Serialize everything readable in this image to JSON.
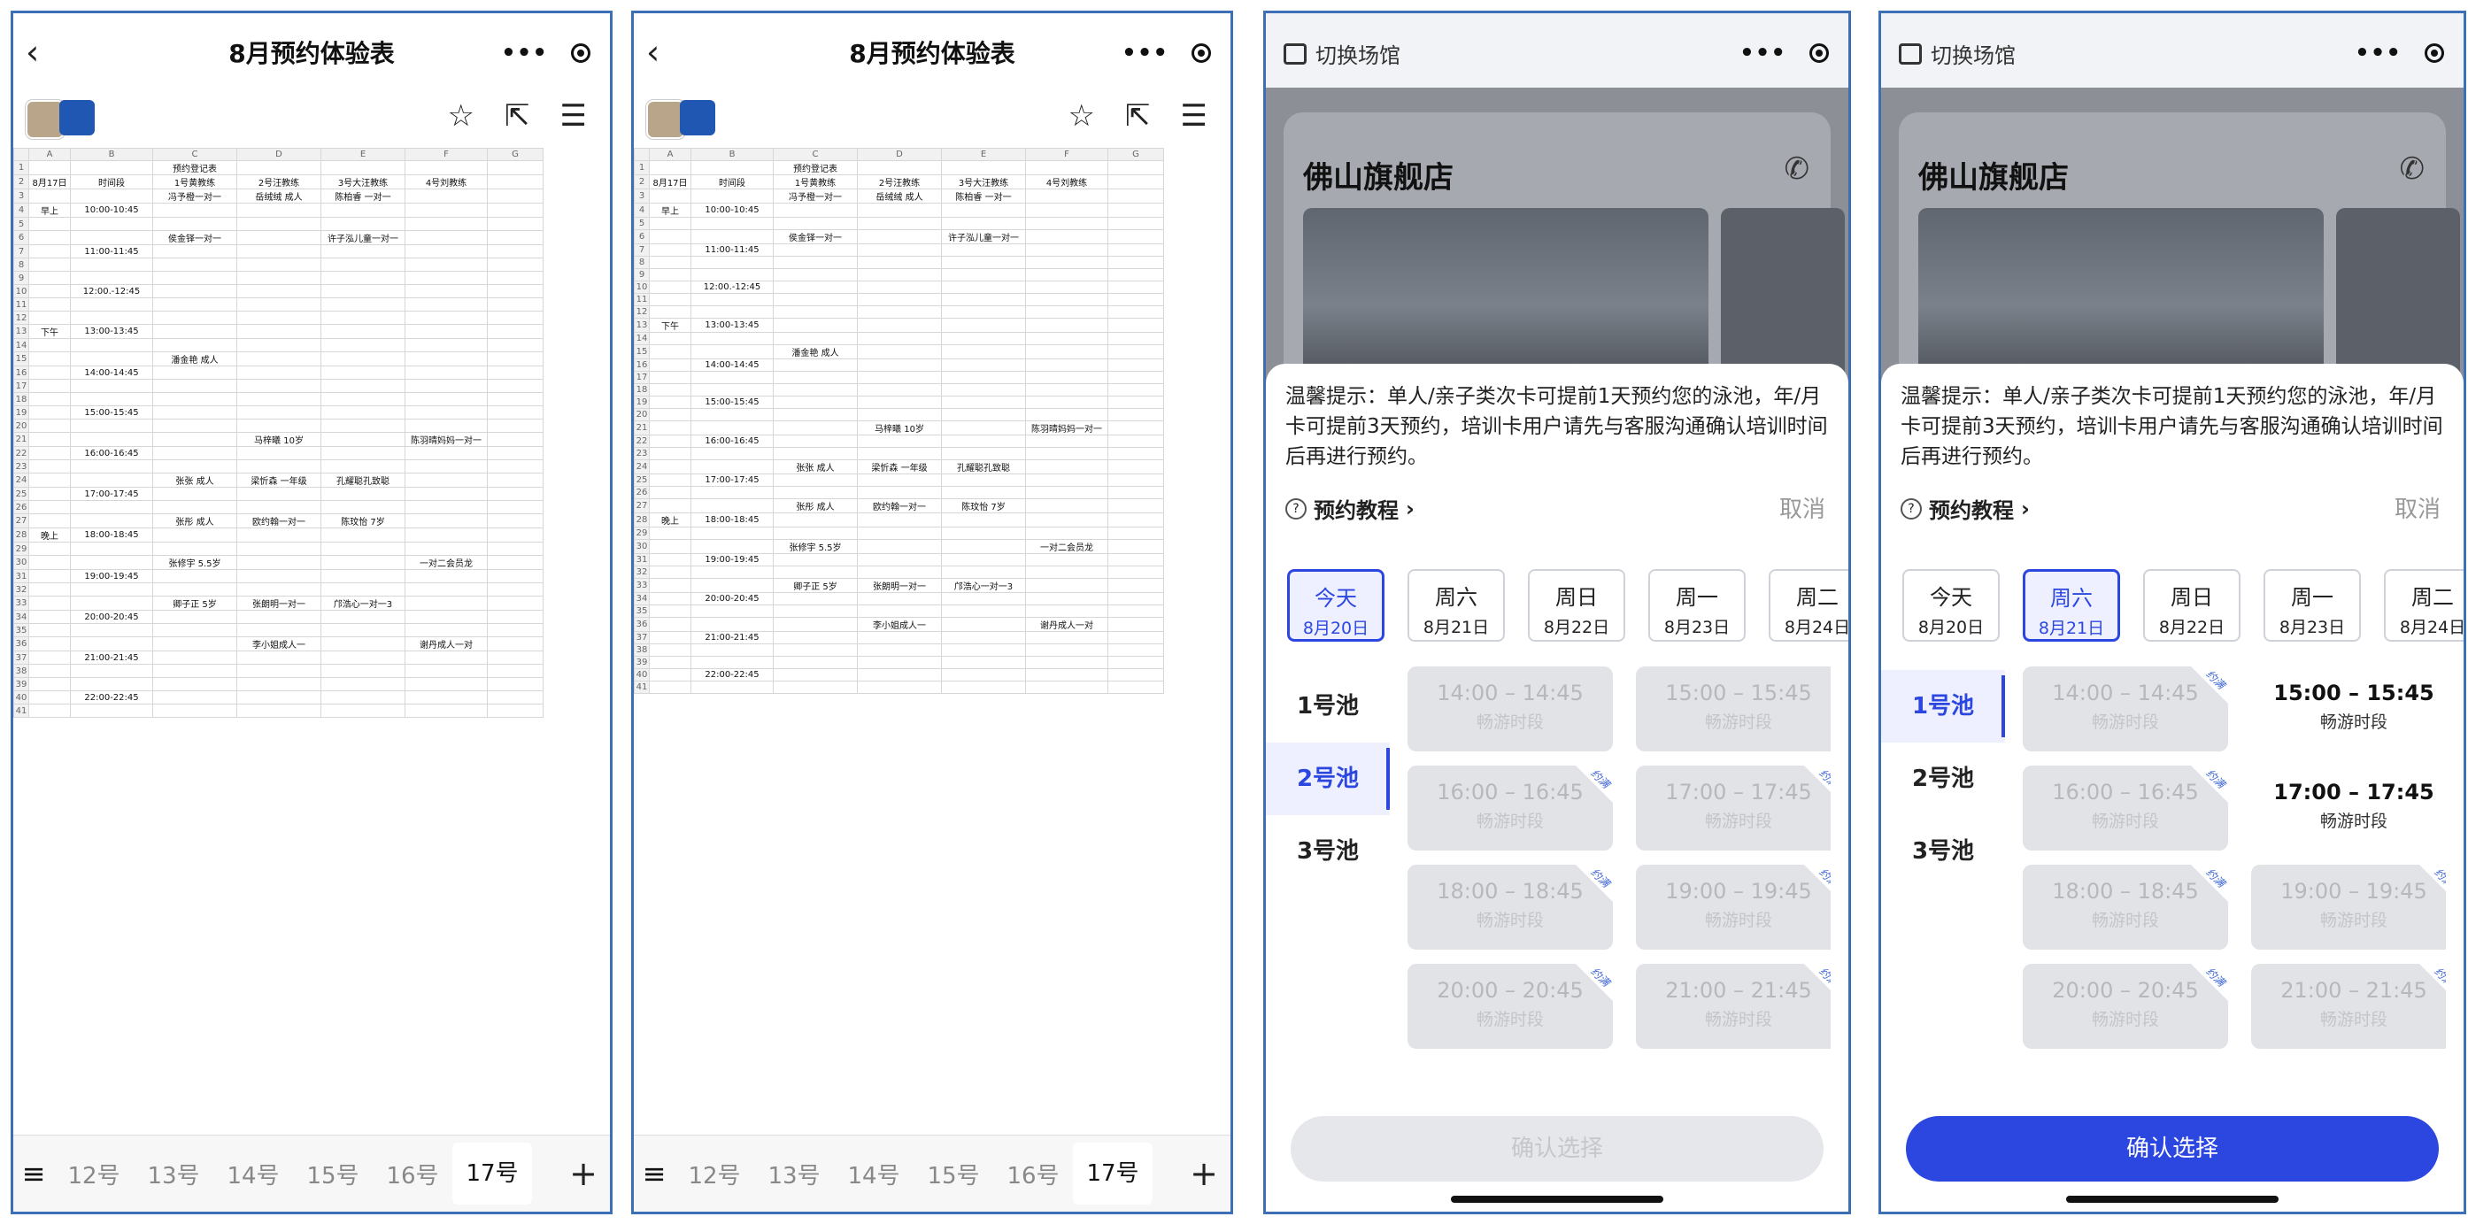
{
  "sheet_app": {
    "title": "8月预约体验表",
    "tabs": [
      "12号",
      "13号",
      "14号",
      "15号",
      "16号",
      "17号"
    ],
    "active_tab": "17号",
    "col_letters": [
      "A",
      "B",
      "C",
      "D",
      "E",
      "F",
      "G"
    ],
    "sheet_title": "预约登记表",
    "headers": [
      "8月17日",
      "时间段",
      "1号黄教练",
      "2号汪教练",
      "3号大汪教练",
      "4号刘教练"
    ],
    "periods": [
      "早上",
      "下午",
      "晚上"
    ],
    "timeslots": [
      "10:00-10:45",
      "11:00-11:45",
      "12:00.-12:45",
      "13:00-13:45",
      "14:00-14:45",
      "15:00-15:45",
      "16:00-16:45",
      "17:00-17:45",
      "18:00-18:45",
      "19:00-19:45",
      "20:00-20:45",
      "21:00-21:45",
      "22:00-22:45"
    ],
    "entries": [
      {
        "slot": 0,
        "col": 1,
        "text": "冯予橙一对一"
      },
      {
        "slot": 0,
        "col": 2,
        "text": "岳绒绒 成人"
      },
      {
        "slot": 0,
        "col": 3,
        "text": "陈柏睿 一对一"
      },
      {
        "slot": 1,
        "col": 1,
        "text": "侯金铎一对一"
      },
      {
        "slot": 1,
        "col": 3,
        "text": "许子泓儿童一对一"
      },
      {
        "slot": 4,
        "col": 1,
        "text": "潘金艳 成人"
      },
      {
        "slot": 6,
        "col": 2,
        "text": "马梓曦 10岁"
      },
      {
        "slot": 6,
        "col": 4,
        "text": "陈羽晴妈妈一对一"
      },
      {
        "slot": 7,
        "col": 1,
        "text": "张张 成人"
      },
      {
        "slot": 7,
        "col": 2,
        "text": "梁忻森 一年级"
      },
      {
        "slot": 7,
        "col": 3,
        "text": "孔耀聪孔致聪"
      },
      {
        "slot": 8,
        "col": 1,
        "text": "张彤 成人"
      },
      {
        "slot": 8,
        "col": 2,
        "text": "欧约翰一对一"
      },
      {
        "slot": 8,
        "col": 3,
        "text": "陈玟怡 7岁"
      },
      {
        "slot": 9,
        "col": 1,
        "text": "张修宇 5.5岁"
      },
      {
        "slot": 9,
        "col": 4,
        "text": "一对二会员龙"
      },
      {
        "slot": 10,
        "col": 1,
        "text": "卿子正 5岁"
      },
      {
        "slot": 10,
        "col": 2,
        "text": "张朗明一对一"
      },
      {
        "slot": 10,
        "col": 3,
        "text": "邝浩心一对一3"
      },
      {
        "slot": 11,
        "col": 2,
        "text": "李小姐成人一"
      },
      {
        "slot": 11,
        "col": 4,
        "text": "谢丹成人一对"
      }
    ]
  },
  "booking": {
    "switch_venue": "切换场馆",
    "store_name": "佛山旗舰店",
    "notice": "温馨提示：单人/亲子类次卡可提前1天预约您的泳池，年/月卡可提前3天预约，培训卡用户请先与客服沟通确认培训时间后再进行预约。",
    "tutorial": "预约教程",
    "cancel": "取消",
    "confirm": "确认选择",
    "booked_tag": "约满",
    "slot_kind": "畅游时段",
    "days": [
      {
        "week": "今天",
        "date": "8月20日"
      },
      {
        "week": "周六",
        "date": "8月21日"
      },
      {
        "week": "周日",
        "date": "8月22日"
      },
      {
        "week": "周一",
        "date": "8月23日"
      },
      {
        "week": "周二",
        "date": "8月24日"
      }
    ],
    "pools": [
      "1号池",
      "2号池",
      "3号池"
    ],
    "slots_today": [
      {
        "time": "14:00 – 14:45",
        "booked": false,
        "open": false
      },
      {
        "time": "15:00 – 15:45",
        "booked": false,
        "open": false
      },
      {
        "time": "16:00 – 16:45",
        "booked": true,
        "open": false
      },
      {
        "time": "17:00 – 17:45",
        "booked": true,
        "open": false
      },
      {
        "time": "18:00 – 18:45",
        "booked": true,
        "open": false
      },
      {
        "time": "19:00 – 19:45",
        "booked": true,
        "open": false
      },
      {
        "time": "20:00 – 20:45",
        "booked": true,
        "open": false
      },
      {
        "time": "21:00 – 21:45",
        "booked": true,
        "open": false
      }
    ],
    "slots_sat": [
      {
        "time": "14:00 – 14:45",
        "booked": true,
        "open": false
      },
      {
        "time": "15:00 – 15:45",
        "booked": false,
        "open": true
      },
      {
        "time": "16:00 – 16:45",
        "booked": true,
        "open": false
      },
      {
        "time": "17:00 – 17:45",
        "booked": false,
        "open": true
      },
      {
        "time": "18:00 – 18:45",
        "booked": true,
        "open": false
      },
      {
        "time": "19:00 – 19:45",
        "booked": true,
        "open": false
      },
      {
        "time": "20:00 – 20:45",
        "booked": true,
        "open": false
      },
      {
        "time": "21:00 – 21:45",
        "booked": true,
        "open": false
      }
    ]
  },
  "panel_state": {
    "p3": {
      "day_selected": "今天",
      "pool_selected": "2号池",
      "confirm_enabled": false
    },
    "p4": {
      "day_selected": "周六",
      "pool_selected": "1号池",
      "confirm_enabled": true
    }
  }
}
